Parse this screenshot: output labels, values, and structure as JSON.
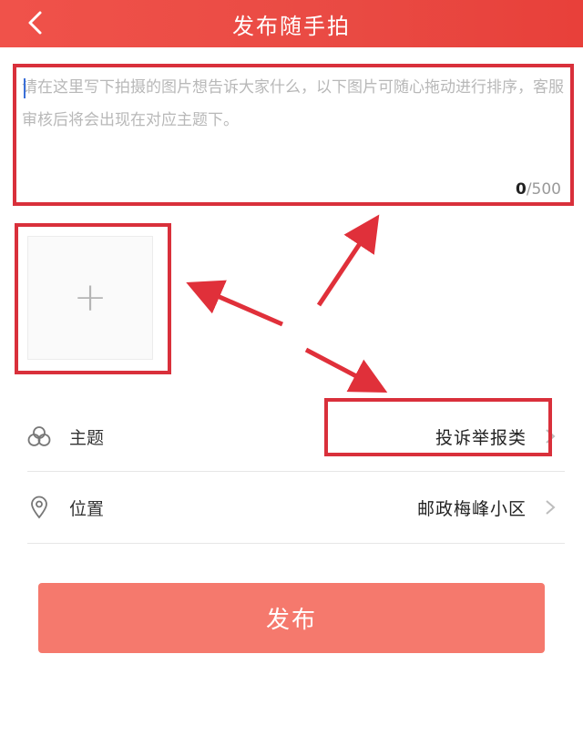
{
  "header": {
    "title": "发布随手拍"
  },
  "post": {
    "placeholder": "请在这里写下拍摄的图片想告诉大家什么，以下图片可随心拖动进行排序，客服审核后将会出现在对应主题下。",
    "count_current": "0",
    "count_max": "/500"
  },
  "photo": {
    "add_symbol": "+"
  },
  "fields": {
    "topic": {
      "label": "主题",
      "value": "投诉举报类"
    },
    "location": {
      "label": "位置",
      "value": "邮政梅峰小区"
    }
  },
  "actions": {
    "publish_label": "发布"
  },
  "colors": {
    "header": "#e94a43",
    "annotation": "#d9303b",
    "publish_button": "#f5796d"
  },
  "icons": {
    "back": "chevron-left-icon",
    "topic": "topic-circles-icon",
    "location": "location-pin-icon",
    "chevron": "chevron-right-icon"
  }
}
